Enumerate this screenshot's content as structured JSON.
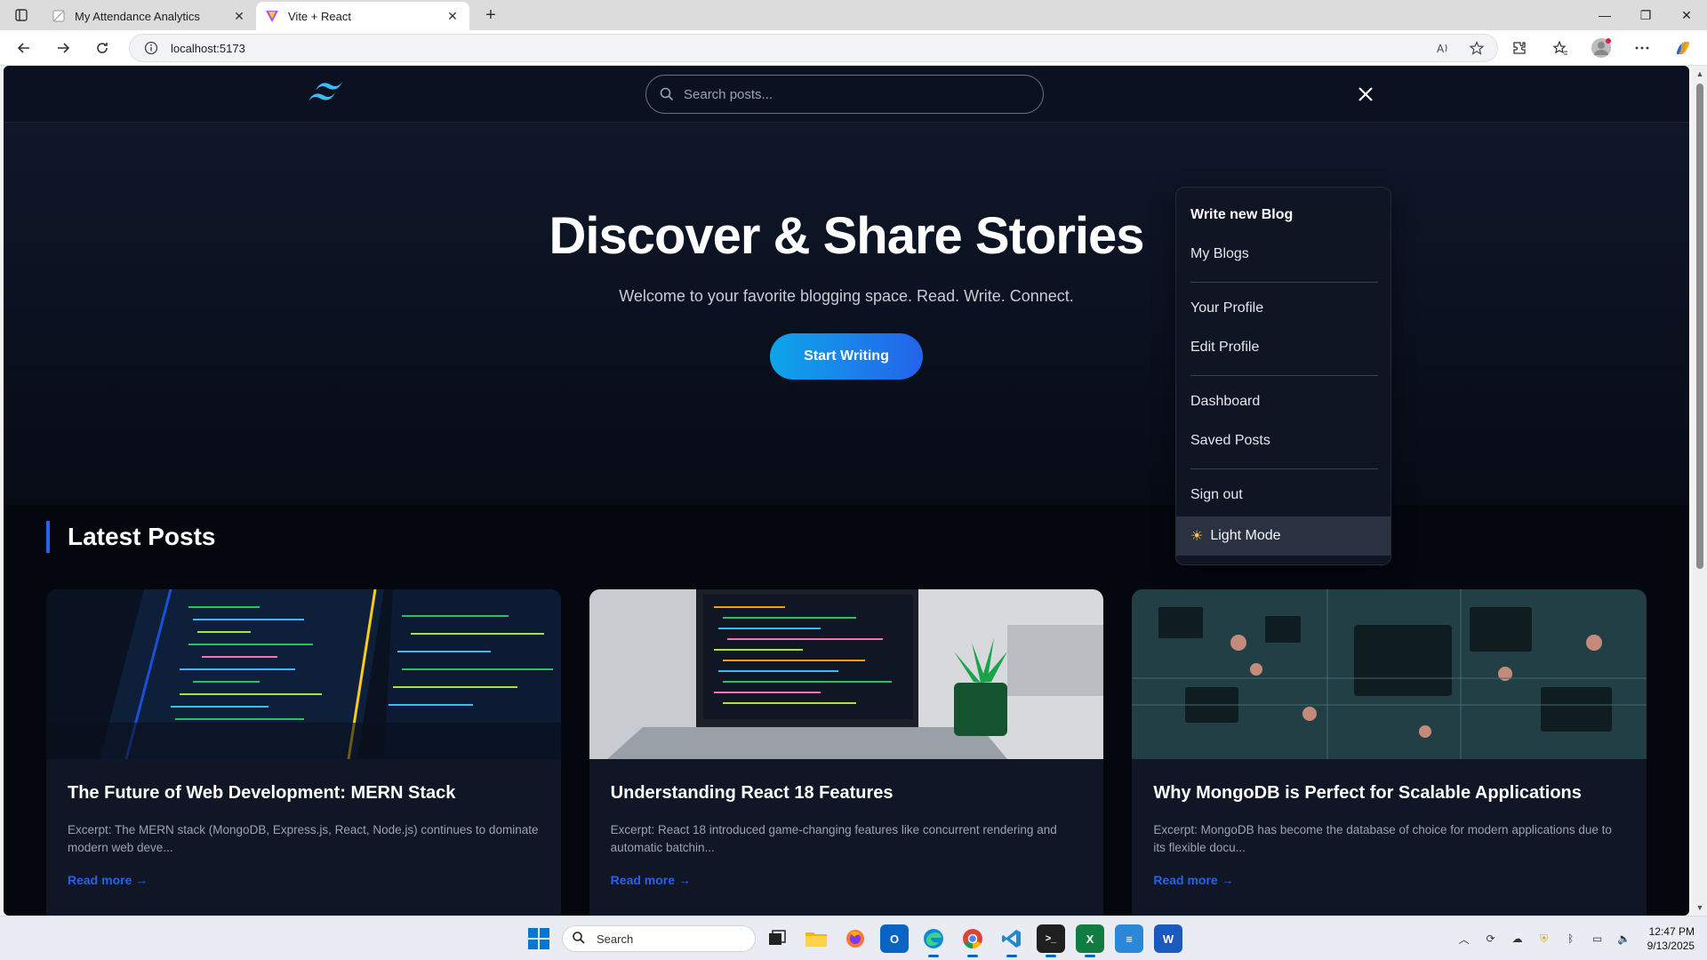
{
  "browser": {
    "tabs": [
      {
        "title": "My Attendance Analytics",
        "active": false
      },
      {
        "title": "Vite + React",
        "active": true
      }
    ],
    "url": "localhost:5173"
  },
  "site": {
    "search_placeholder": "Search posts...",
    "hero": {
      "title": "Discover & Share Stories",
      "subtitle": "Welcome to your favorite blogging space. Read. Write. Connect.",
      "cta": "Start Writing"
    },
    "section_title": "Latest Posts",
    "posts": [
      {
        "title": "The Future of Web Development: MERN Stack",
        "excerpt": "Excerpt: The MERN stack (MongoDB, Express.js, React, Node.js) continues to dominate modern web deve...",
        "read_more": "Read more →"
      },
      {
        "title": "Understanding React 18 Features",
        "excerpt": "Excerpt: React 18 introduced game-changing features like concurrent rendering and automatic batchin...",
        "read_more": "Read more →"
      },
      {
        "title": "Why MongoDB is Perfect for Scalable Applications",
        "excerpt": "Excerpt: MongoDB has become the database of choice for modern applications due to its flexible docu...",
        "read_more": "Read more →"
      }
    ],
    "menu": {
      "write_new": "Write new Blog",
      "my_blogs": "My Blogs",
      "your_profile": "Your Profile",
      "edit_profile": "Edit Profile",
      "dashboard": "Dashboard",
      "saved_posts": "Saved Posts",
      "sign_out": "Sign out",
      "light_mode": "Light Mode"
    }
  },
  "taskbar": {
    "search_label": "Search",
    "time": "12:47 PM",
    "date": "9/13/2025"
  },
  "colors": {
    "accent": "#2563eb",
    "cta_start": "#0ea5e9",
    "page_bg": "#05070f",
    "logo": "#38bdf8"
  }
}
